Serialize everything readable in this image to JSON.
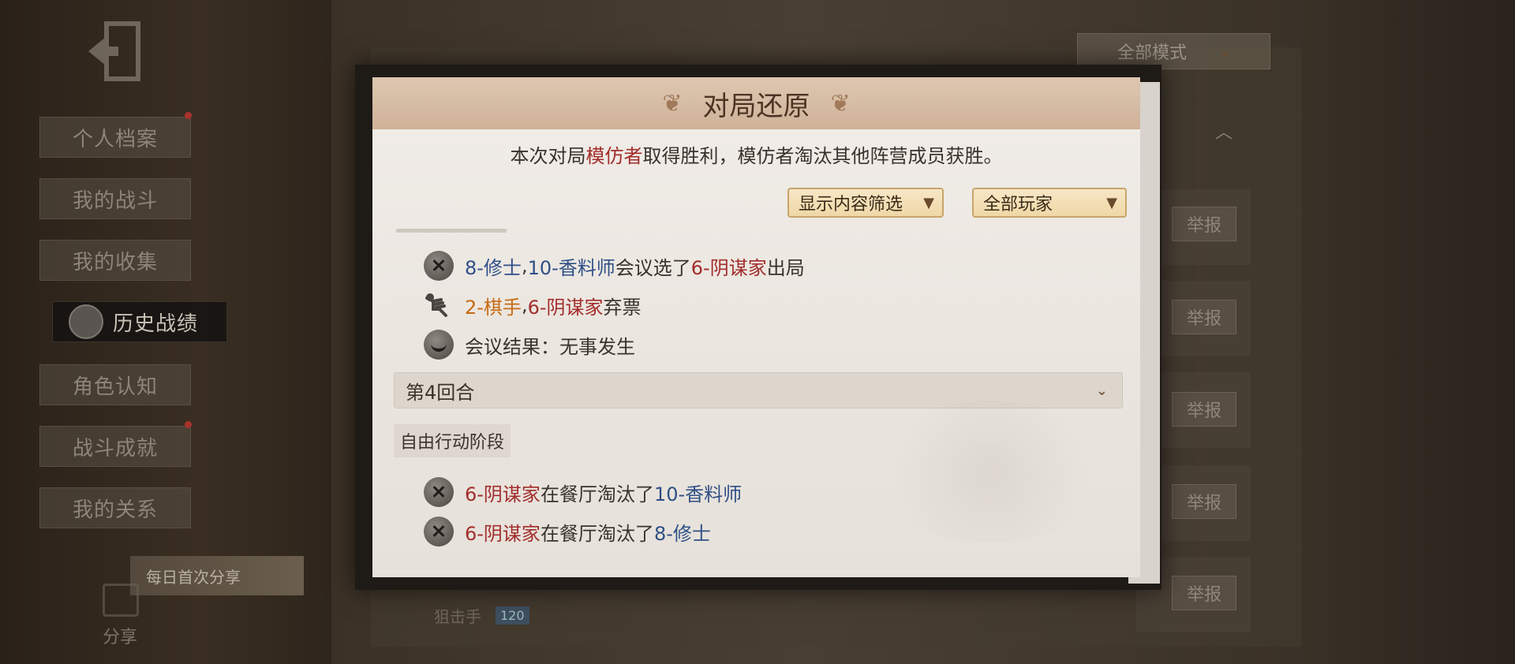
{
  "sidebar": {
    "items": [
      {
        "label": "个人档案",
        "badge": true
      },
      {
        "label": "我的战斗",
        "badge": false
      },
      {
        "label": "我的收集",
        "badge": false
      },
      {
        "label": "历史战绩",
        "badge": false,
        "active": true
      },
      {
        "label": "角色认知",
        "badge": false
      },
      {
        "label": "战斗成就",
        "badge": true
      },
      {
        "label": "我的关系",
        "badge": false
      }
    ],
    "share_banner": "每日首次分享",
    "share_label": "分享"
  },
  "background": {
    "mode_select": "全部模式",
    "report_label": "举报",
    "row_player": "狙击手",
    "row_tag": "120"
  },
  "modal": {
    "title": "对局还原",
    "announce": {
      "prefix": "本次对局",
      "winner": "模仿者",
      "suffix": "取得胜利，模仿者淘汰其他阵营成员获胜。"
    },
    "filter_content": "显示内容筛选",
    "filter_players": "全部玩家",
    "events_top": [
      {
        "icon": "dead-face-icon",
        "p1": "8-修士",
        "sep": ", ",
        "p2": "10-香料师",
        "mid": "会议选了",
        "p3": "6-阴谋家",
        "end": "出局"
      },
      {
        "icon": "fishbone-icon",
        "p1": "2-棋手",
        "sep": ", ",
        "p2": "6-阴谋家",
        "end": "弃票"
      },
      {
        "icon": "smile-face-icon",
        "text": "会议结果：无事发生"
      }
    ],
    "round_label": "第4回合",
    "phase_label": "自由行动阶段",
    "events_bottom": [
      {
        "p1": "6-阴谋家",
        "mid": "在餐厅淘汰了",
        "p2": "10-香料师"
      },
      {
        "p1": "6-阴谋家",
        "mid": "在餐厅淘汰了",
        "p2": "8-修士"
      }
    ]
  }
}
